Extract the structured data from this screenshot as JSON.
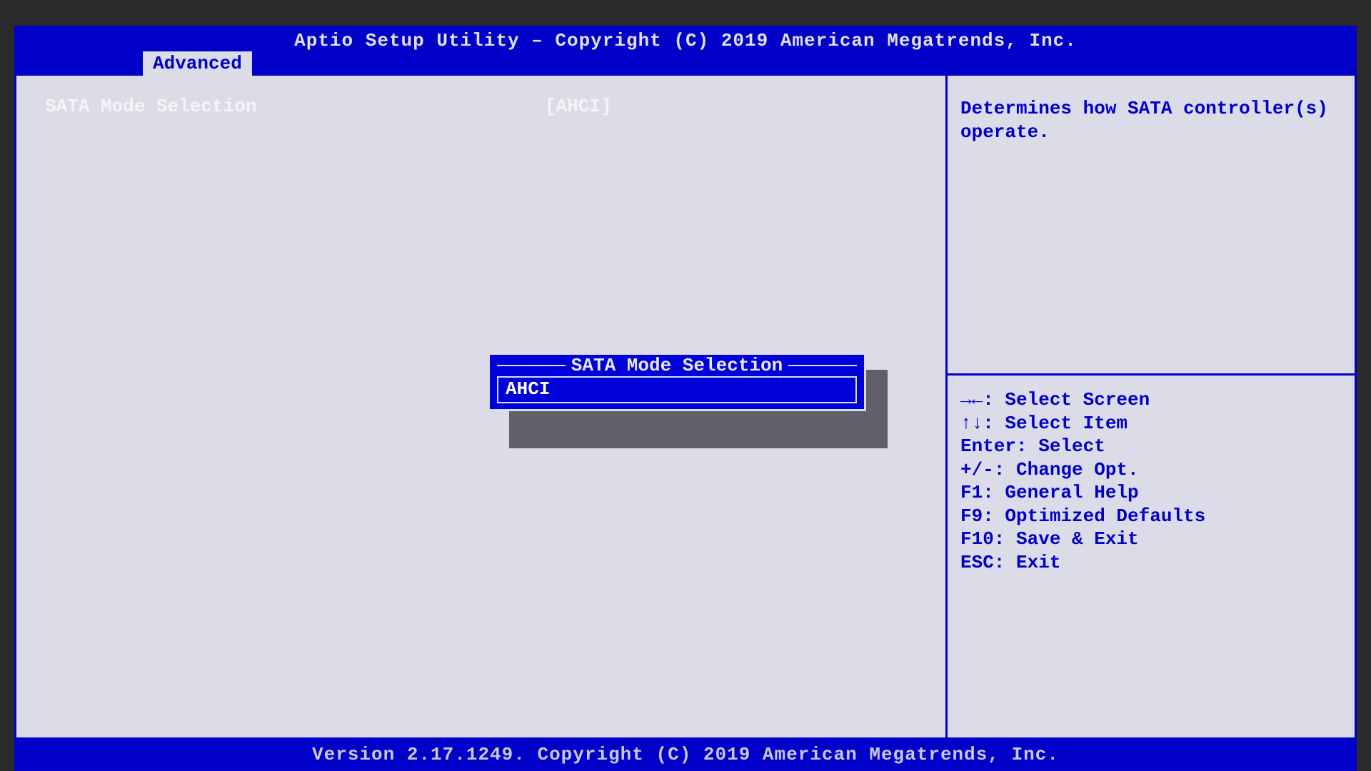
{
  "header": {
    "title": "Aptio Setup Utility – Copyright (C) 2019 American Megatrends, Inc.",
    "active_tab": "Advanced"
  },
  "main": {
    "setting_label": "SATA Mode Selection",
    "setting_value": "[AHCI]"
  },
  "popup": {
    "title": "SATA Mode Selection",
    "options": [
      "AHCI"
    ],
    "selected": "AHCI"
  },
  "help": {
    "description": "Determines how SATA controller(s) operate.",
    "keys": {
      "select_screen": "→←: Select Screen",
      "select_item": "↑↓: Select Item",
      "enter": "Enter: Select",
      "change": "+/-: Change Opt.",
      "f1": "F1: General Help",
      "f9": "F9: Optimized Defaults",
      "f10": "F10: Save & Exit",
      "esc": "ESC: Exit"
    }
  },
  "footer": {
    "text": "Version 2.17.1249. Copyright (C) 2019 American Megatrends, Inc."
  }
}
